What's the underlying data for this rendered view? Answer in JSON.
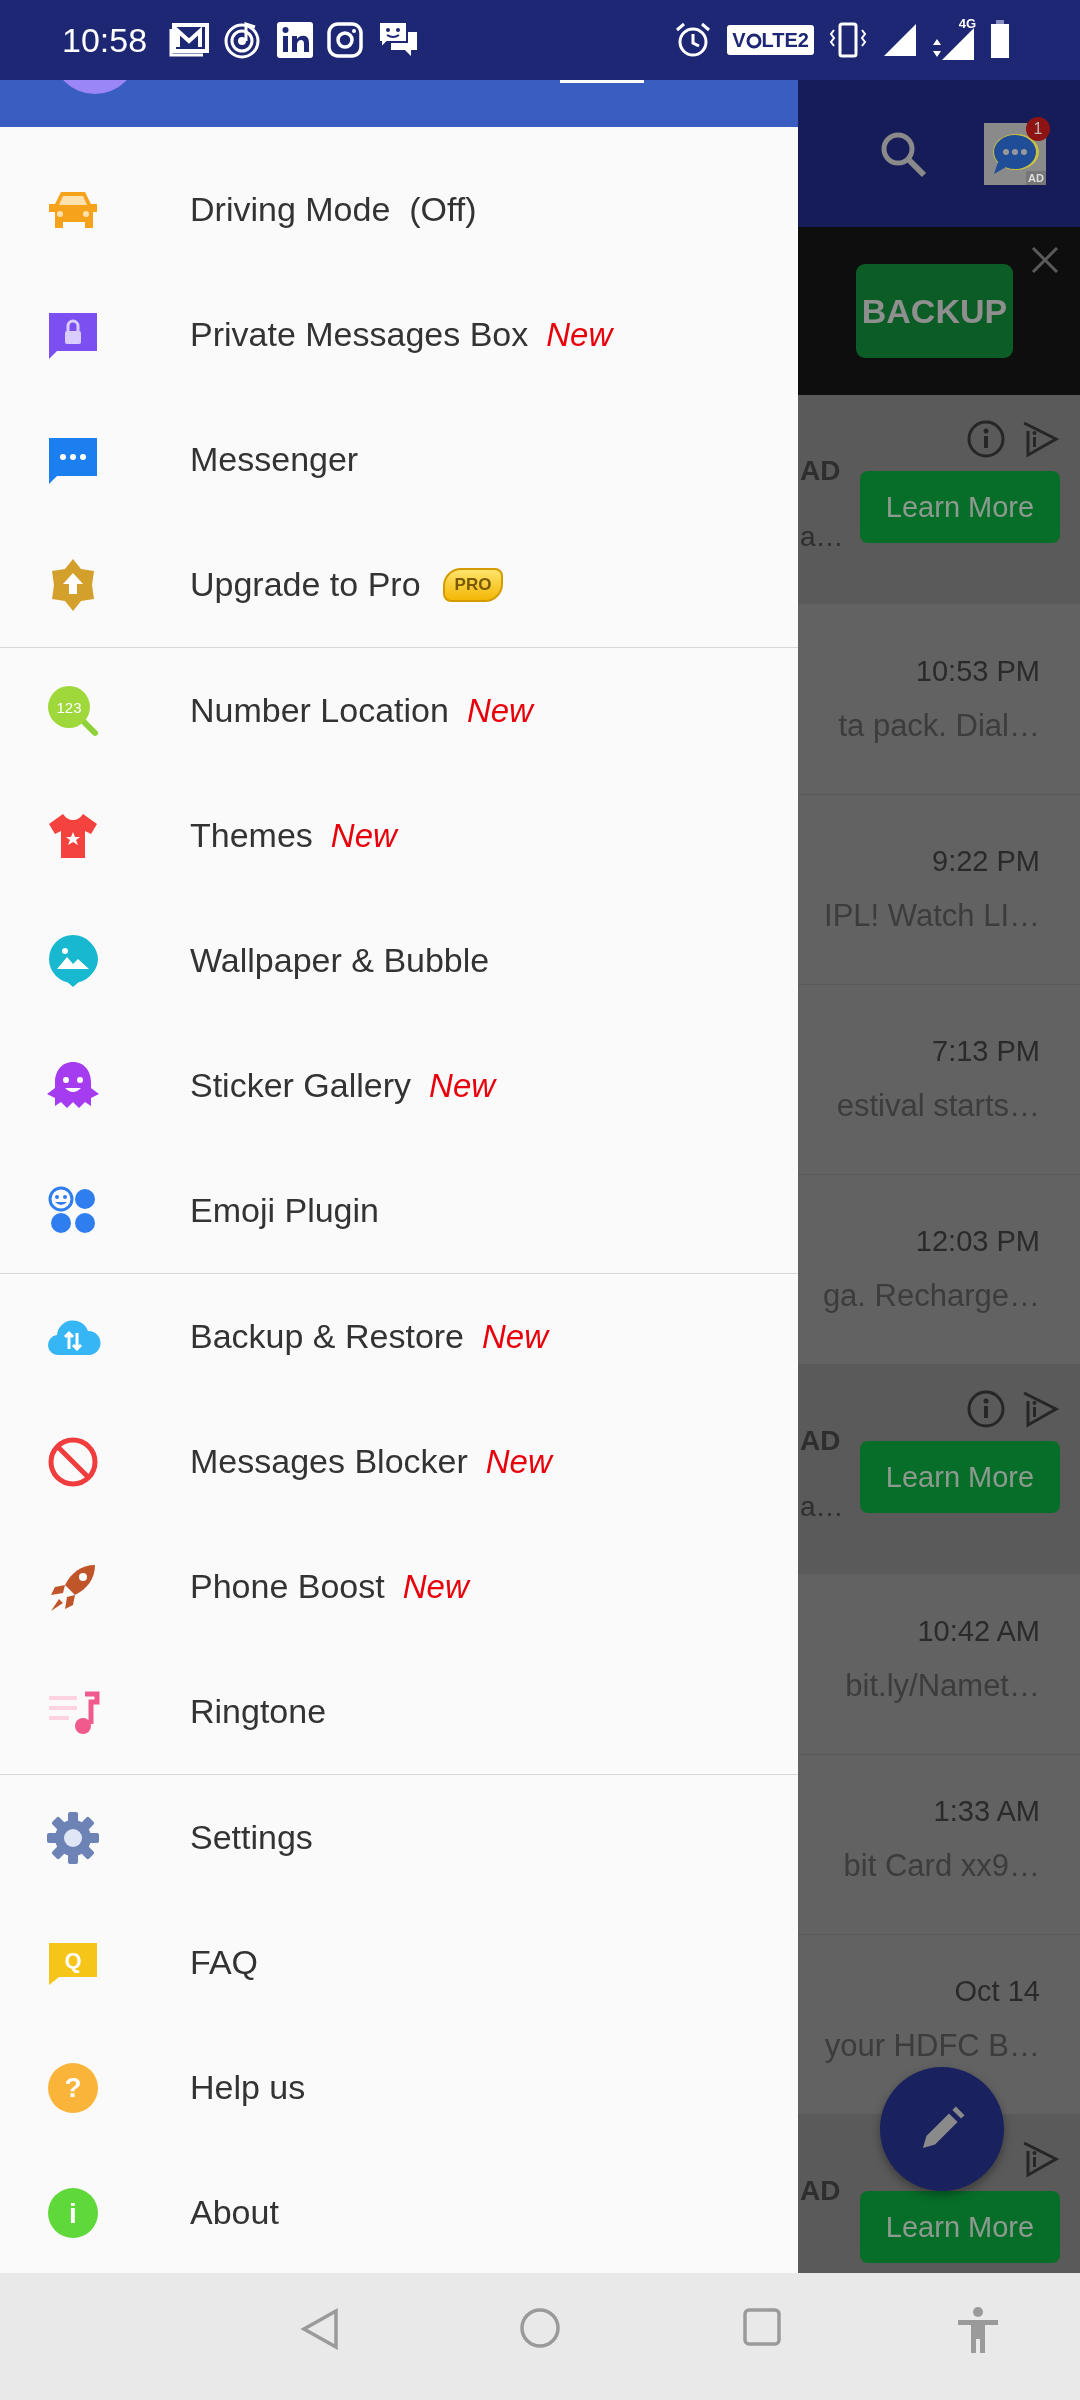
{
  "status_bar": {
    "time": "10:58",
    "volte": [
      "V",
      "LTE2"
    ],
    "network": "4G"
  },
  "drawer": {
    "sections": [
      {
        "items": [
          {
            "label": "Driving Mode  (Off)"
          },
          {
            "label": "Private Messages Box",
            "badge": {
              "kind": "new",
              "text": "New"
            }
          },
          {
            "label": "Messenger"
          },
          {
            "label": "Upgrade to Pro",
            "badge": {
              "kind": "pro",
              "text": "PRO"
            }
          }
        ]
      },
      {
        "items": [
          {
            "label": "Number Location",
            "icon_text": "123",
            "badge": {
              "kind": "new",
              "text": "New"
            }
          },
          {
            "label": "Themes",
            "badge": {
              "kind": "new",
              "text": "New"
            }
          },
          {
            "label": "Wallpaper & Bubble"
          },
          {
            "label": "Sticker Gallery",
            "badge": {
              "kind": "new",
              "text": "New"
            }
          },
          {
            "label": "Emoji Plugin"
          }
        ]
      },
      {
        "items": [
          {
            "label": "Backup & Restore",
            "badge": {
              "kind": "new",
              "text": "New"
            }
          },
          {
            "label": "Messages Blocker",
            "badge": {
              "kind": "new",
              "text": "New"
            }
          },
          {
            "label": "Phone Boost",
            "badge": {
              "kind": "new",
              "text": "New"
            }
          },
          {
            "label": "Ringtone"
          }
        ]
      },
      {
        "items": [
          {
            "label": "Settings"
          },
          {
            "label": "FAQ",
            "icon_text": "Q"
          },
          {
            "label": "Help us",
            "icon_text": "?"
          },
          {
            "label": "About",
            "icon_text": "i"
          }
        ]
      }
    ]
  },
  "toolbar": {
    "app_badge": "1",
    "app_label": "AD"
  },
  "banner": {
    "button": "BACKUP"
  },
  "list": [
    {
      "kind": "ad",
      "label": "AD",
      "snippet": "a…",
      "button": "Learn More"
    },
    {
      "kind": "message",
      "time": "10:53 PM",
      "snippet": "ta pack. Dial…"
    },
    {
      "kind": "message",
      "time": "9:22 PM",
      "snippet": "IPL! Watch LI…"
    },
    {
      "kind": "message",
      "time": "7:13 PM",
      "snippet": "estival starts…"
    },
    {
      "kind": "message",
      "time": "12:03 PM",
      "snippet": "ga. Recharge…"
    },
    {
      "kind": "ad",
      "label": "AD",
      "snippet": "a…",
      "button": "Learn More"
    },
    {
      "kind": "message",
      "time": "10:42 AM",
      "snippet": "bit.ly/Namet…"
    },
    {
      "kind": "message",
      "time": "1:33 AM",
      "snippet": "bit Card xx9…"
    },
    {
      "kind": "message",
      "time": "Oct 14",
      "snippet": "your HDFC B…"
    },
    {
      "kind": "ad",
      "label": "AD",
      "button": "Learn More"
    }
  ]
}
